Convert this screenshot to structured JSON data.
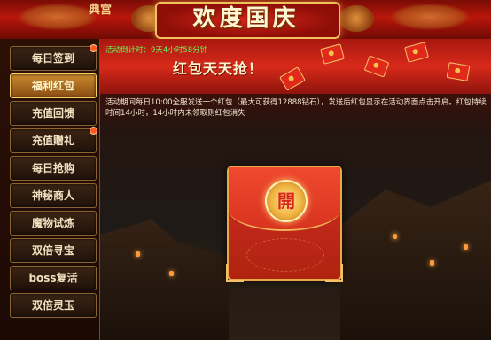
{
  "header": {
    "title": "欢度国庆",
    "corner_text": "典宫"
  },
  "sidebar": {
    "items": [
      {
        "label": "每日签到",
        "badge": true,
        "active": false
      },
      {
        "label": "福利红包",
        "badge": false,
        "active": true
      },
      {
        "label": "充值回馈",
        "badge": false,
        "active": false
      },
      {
        "label": "充值赠礼",
        "badge": true,
        "active": false
      },
      {
        "label": "每日抢购",
        "badge": false,
        "active": false
      },
      {
        "label": "神秘商人",
        "badge": false,
        "active": false
      },
      {
        "label": "魔物试炼",
        "badge": false,
        "active": false
      },
      {
        "label": "双倍寻宝",
        "badge": false,
        "active": false
      },
      {
        "label": "boss复活",
        "badge": false,
        "active": false
      },
      {
        "label": "双倍灵玉",
        "badge": false,
        "active": false
      }
    ]
  },
  "main": {
    "timer": "活动倒计时：9天4小时58分钟",
    "banner_title": "红包天天抢！",
    "description": "活动期间每日10:00全服发送一个红包（最大可获得12888钻石），发送后红包显示在活动界面点击开启。红包持续时间14小时，14小时内未领取则红包消失",
    "packet": {
      "open_label": "開"
    }
  },
  "colors": {
    "accent_gold": "#f0c15c",
    "festive_red": "#d82a1a",
    "timer_green": "#6ef05c"
  }
}
